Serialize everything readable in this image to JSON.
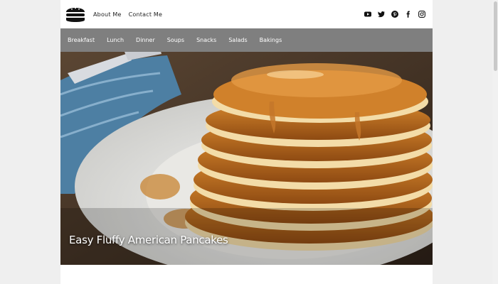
{
  "header": {
    "logo_icon": "burger-logo-icon",
    "links": [
      "About Me",
      "Contact Me"
    ],
    "socials": [
      "youtube-icon",
      "twitter-icon",
      "pinterest-icon",
      "facebook-icon",
      "instagram-icon"
    ]
  },
  "nav": {
    "categories": [
      "Breakfast",
      "Lunch",
      "Dinner",
      "Soups",
      "Snacks",
      "Salads",
      "Bakings"
    ]
  },
  "hero": {
    "title": "Easy Fluffy American Pancakes"
  },
  "colors": {
    "nav_bg": "#7f7f7f",
    "page_bg": "#efefef"
  }
}
